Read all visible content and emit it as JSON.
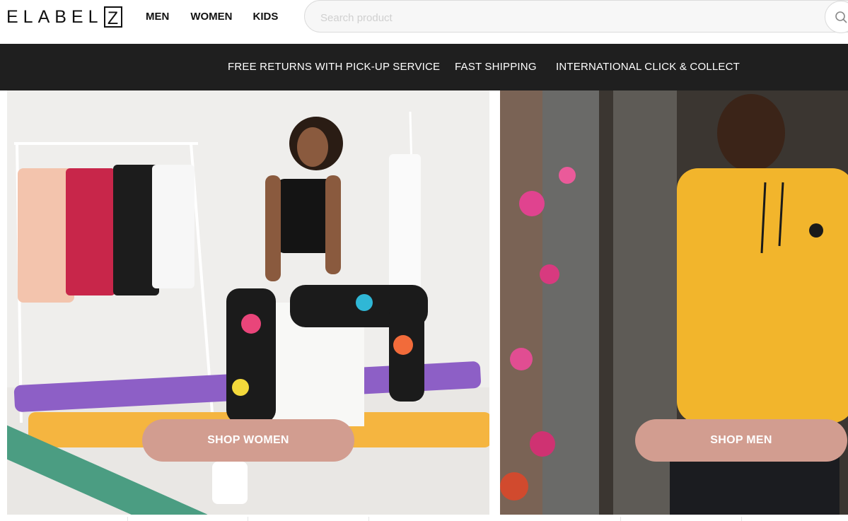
{
  "header": {
    "logo_text": "ELABEL",
    "logo_box_letter": "Z",
    "nav": [
      {
        "label": "MEN"
      },
      {
        "label": "WOMEN"
      },
      {
        "label": "KIDS"
      }
    ],
    "search": {
      "placeholder": "Search product",
      "icon": "search-icon"
    }
  },
  "promo_bar": {
    "items": [
      {
        "label": "FREE RETURNS WITH PICK-UP SERVICE"
      },
      {
        "label": "FAST SHIPPING"
      },
      {
        "label": "INTERNATIONAL CLICK & COLLECT"
      }
    ]
  },
  "hero": {
    "women": {
      "button_label": "SHOP WOMEN"
    },
    "men": {
      "button_label": "SHOP MEN"
    }
  },
  "colors": {
    "promo_bg": "#1f1f1f",
    "button_bg": "#d29d90",
    "men_jacket": "#f2b52c"
  }
}
